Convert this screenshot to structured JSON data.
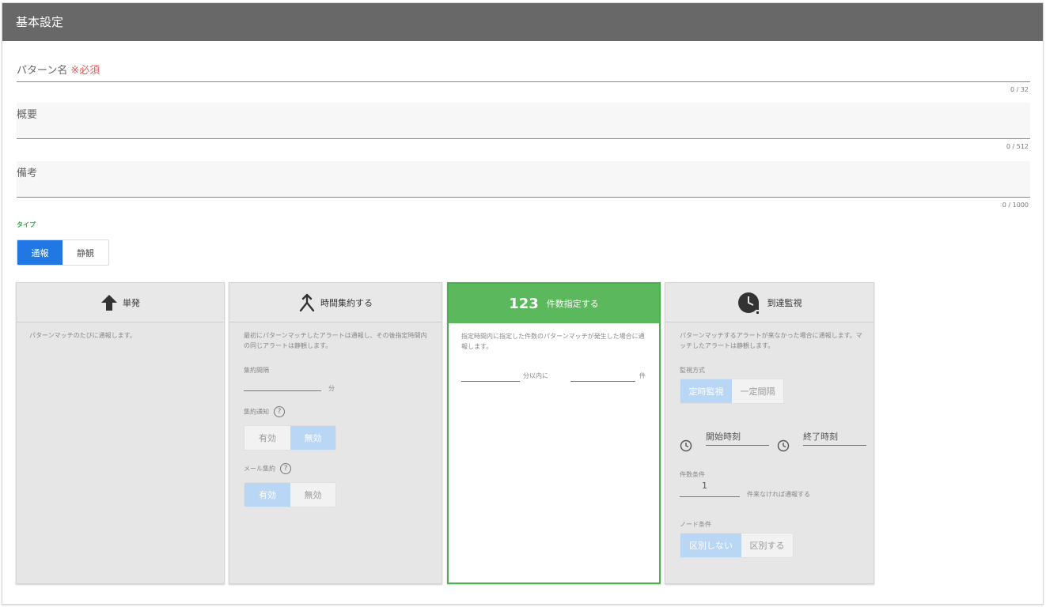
{
  "header": {
    "title": "基本設定"
  },
  "form": {
    "pattern_name": {
      "label": "パターン名",
      "required": "※必須",
      "counter": "0 / 32"
    },
    "summary": {
      "label": "概要",
      "counter": "0 / 512"
    },
    "note": {
      "label": "備考",
      "counter": "0 / 1000"
    },
    "type_label": "タイプ",
    "type_options": [
      "通報",
      "静観"
    ],
    "type_selected": "通報"
  },
  "cards": {
    "single": {
      "title": "単発",
      "icon": "arrow-up-icon",
      "desc": "パターンマッチのたびに通報します。"
    },
    "time_aggregate": {
      "title": "時間集約する",
      "icon": "merge-arrow-icon",
      "desc": "最初にパターンマッチしたアラートは通報し、その後指定時間内の同じアラートは静観します。",
      "interval_label": "集約間隔",
      "interval_unit": "分",
      "notify_label": "集約通知",
      "notify_options": [
        "有効",
        "無効"
      ],
      "notify_selected": "無効",
      "mail_label": "メール集約",
      "mail_options": [
        "有効",
        "無効"
      ],
      "mail_selected": "有効"
    },
    "count": {
      "title": "件数指定する",
      "icon_text": "123",
      "desc": "指定時間内に指定した件数のパターンマッチが発生した場合に通報します。",
      "minutes_unit": "分以内に",
      "count_unit": "件"
    },
    "arrival": {
      "title": "到達監視",
      "icon": "clock-alert-icon",
      "desc": "パターンマッチするアラートが来なかった場合に通報します。マッチしたアラートは静観します。",
      "method_label": "監視方式",
      "method_options": [
        "定時監視",
        "一定間隔"
      ],
      "method_selected": "定時監視",
      "start_label": "開始時刻",
      "end_label": "終了時刻",
      "count_cond_label": "件数条件",
      "count_value": "1",
      "count_suffix": "件来なければ通報する",
      "node_label": "ノード条件",
      "node_options": [
        "区別しない",
        "区別する"
      ],
      "node_selected": "区別しない"
    }
  },
  "colors": {
    "header_bg": "#686868",
    "primary": "#2178e5",
    "selected_card": "#5cb85c",
    "required": "#e05a5a"
  }
}
